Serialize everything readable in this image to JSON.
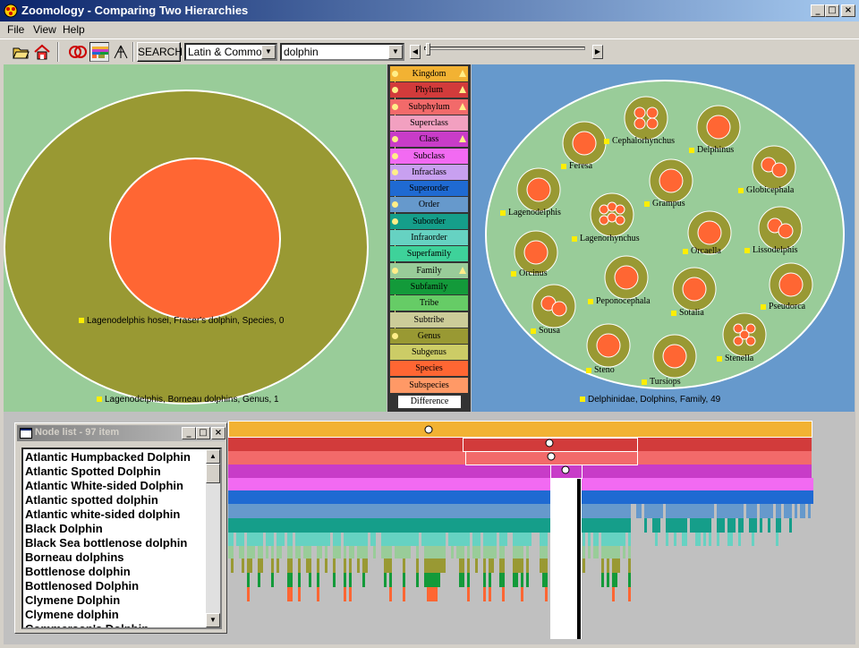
{
  "window": {
    "title": "Zoomology - Comparing Two Hierarchies"
  },
  "menu": [
    "File",
    "View",
    "Help"
  ],
  "toolbar": {
    "search_label": "SEARCH",
    "name_mode": "Latin & Common",
    "search_value": "dolphin"
  },
  "left_view": {
    "outer_label": "Lagenodelphis, Borneau dolphins, Genus, 1",
    "inner_label": "Lagenodelphis hosei, Fraser's dolphin, Species, 0"
  },
  "right_view": {
    "outer_label": "Delphinidae, Dolphins, Family, 49",
    "genera": [
      "Cephalorhynchus",
      "Delphinus",
      "Feresa",
      "Globicephala",
      "Grampus",
      "Lagenodelphis",
      "Lagenorhynchus",
      "Lissodelphis",
      "Orcaella",
      "Orcinus",
      "Peponocephala",
      "Pseudorca",
      "Sotalia",
      "Sousa",
      "Stenella",
      "Steno",
      "Tursiops"
    ]
  },
  "legend": [
    {
      "label": "Kingdom",
      "color": "#f2b233"
    },
    {
      "label": "Phylum",
      "color": "#d23b3b"
    },
    {
      "label": "Subphylum",
      "color": "#f26a6a"
    },
    {
      "label": "Superclass",
      "color": "#f2a0c0"
    },
    {
      "label": "Class",
      "color": "#c83cc8"
    },
    {
      "label": "Subclass",
      "color": "#f26af2"
    },
    {
      "label": "Infraclass",
      "color": "#c8a0f0"
    },
    {
      "label": "Superorder",
      "color": "#1f6ad2"
    },
    {
      "label": "Order",
      "color": "#6699cc"
    },
    {
      "label": "Suborder",
      "color": "#159e8a"
    },
    {
      "label": "Infraorder",
      "color": "#66d2c2"
    },
    {
      "label": "Superfamily",
      "color": "#3ed29a"
    },
    {
      "label": "Family",
      "color": "#99cc99"
    },
    {
      "label": "Subfamily",
      "color": "#139a3a"
    },
    {
      "label": "Tribe",
      "color": "#66cc66"
    },
    {
      "label": "Subtribe",
      "color": "#cccc99"
    },
    {
      "label": "Genus",
      "color": "#999933"
    },
    {
      "label": "Subgenus",
      "color": "#cccc66"
    },
    {
      "label": "Species",
      "color": "#ff6633"
    },
    {
      "label": "Subspecies",
      "color": "#ff9966"
    },
    {
      "label": "Difference",
      "color": "#ffffff"
    }
  ],
  "node_list": {
    "title": "Node list - 97 item",
    "items": [
      "Atlantic Humpbacked Dolphin",
      "Atlantic Spotted Dolphin",
      "Atlantic White-sided Dolphin",
      "Atlantic spotted dolphin",
      "Atlantic white-sided dolphin",
      "Black Dolphin",
      "Black Sea bottlenose dolphin",
      "Borneau dolphins",
      "Bottlenose dolphin",
      "Bottlenosed Dolphin",
      "Clymene Dolphin",
      "Clymene dolphin",
      "Commerson's Dolphin"
    ]
  }
}
